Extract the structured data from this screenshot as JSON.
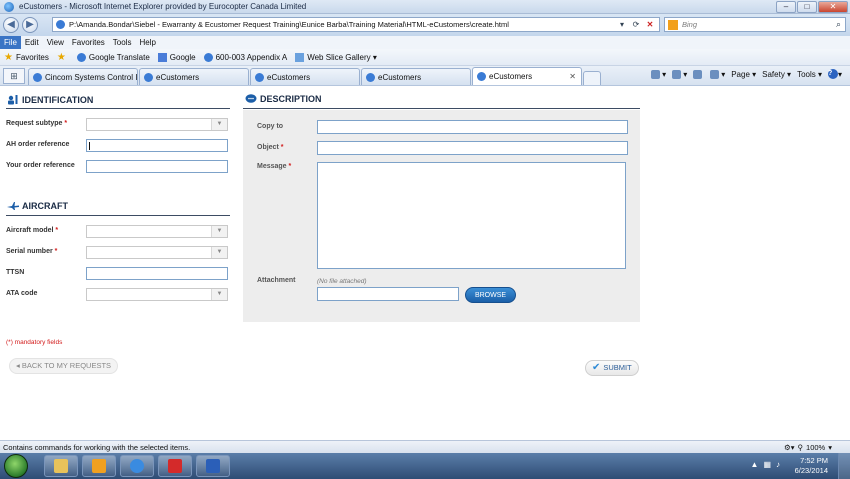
{
  "window": {
    "title": "eCustomers - Microsoft Internet Explorer provided by Eurocopter Canada Limited",
    "controls": {
      "minimize": "–",
      "maximize": "□",
      "close": "✕"
    }
  },
  "address_bar": {
    "url": "P:\\Amanda.Bondar\\Siebel - Ewarranty & Ecustomer Request Training\\Eunice Barba\\Training Material\\HTML-eCustomers\\create.html",
    "search_placeholder": "Bing"
  },
  "menu": [
    "File",
    "Edit",
    "View",
    "Favorites",
    "Tools",
    "Help"
  ],
  "favorites_bar": {
    "favorites_label": "Favorites",
    "items": [
      "Google Translate",
      "Google",
      "600-003 Appendix A",
      "Web Slice Gallery ▾"
    ]
  },
  "tabs": [
    {
      "label": "Cincom Systems Control I..."
    },
    {
      "label": "eCustomers"
    },
    {
      "label": "eCustomers"
    },
    {
      "label": "eCustomers"
    },
    {
      "label": "eCustomers"
    }
  ],
  "command_bar": {
    "page": "Page ▾",
    "safety": "Safety ▾",
    "tools": "Tools ▾"
  },
  "identification": {
    "title": "IDENTIFICATION",
    "fields": [
      {
        "label": "Request subtype",
        "required": "*"
      },
      {
        "label": "AH order reference",
        "required": ""
      },
      {
        "label": "Your order reference",
        "required": ""
      }
    ]
  },
  "aircraft": {
    "title": "AIRCRAFT",
    "fields": [
      {
        "label": "Aircraft model",
        "required": "*"
      },
      {
        "label": "Serial number",
        "required": "*"
      },
      {
        "label": "TTSN",
        "required": ""
      },
      {
        "label": "ATA code",
        "required": ""
      }
    ]
  },
  "description": {
    "title": "DESCRIPTION",
    "copy_to": "Copy to",
    "object": "Object",
    "object_required": "*",
    "message": "Message",
    "message_required": "*",
    "attachment": "Attachment",
    "no_file": "(No file attached)",
    "browse": "BROWSE"
  },
  "mandatory_note": "(*) mandatory fields",
  "back_button": "◂ BACK TO MY REQUESTS",
  "submit_button": "SUBMIT",
  "status_bar": {
    "text": "Contains commands for working with the selected items.",
    "zoom": "100%"
  },
  "taskbar": {
    "time": "7:52 PM",
    "date": "6/23/2014"
  }
}
